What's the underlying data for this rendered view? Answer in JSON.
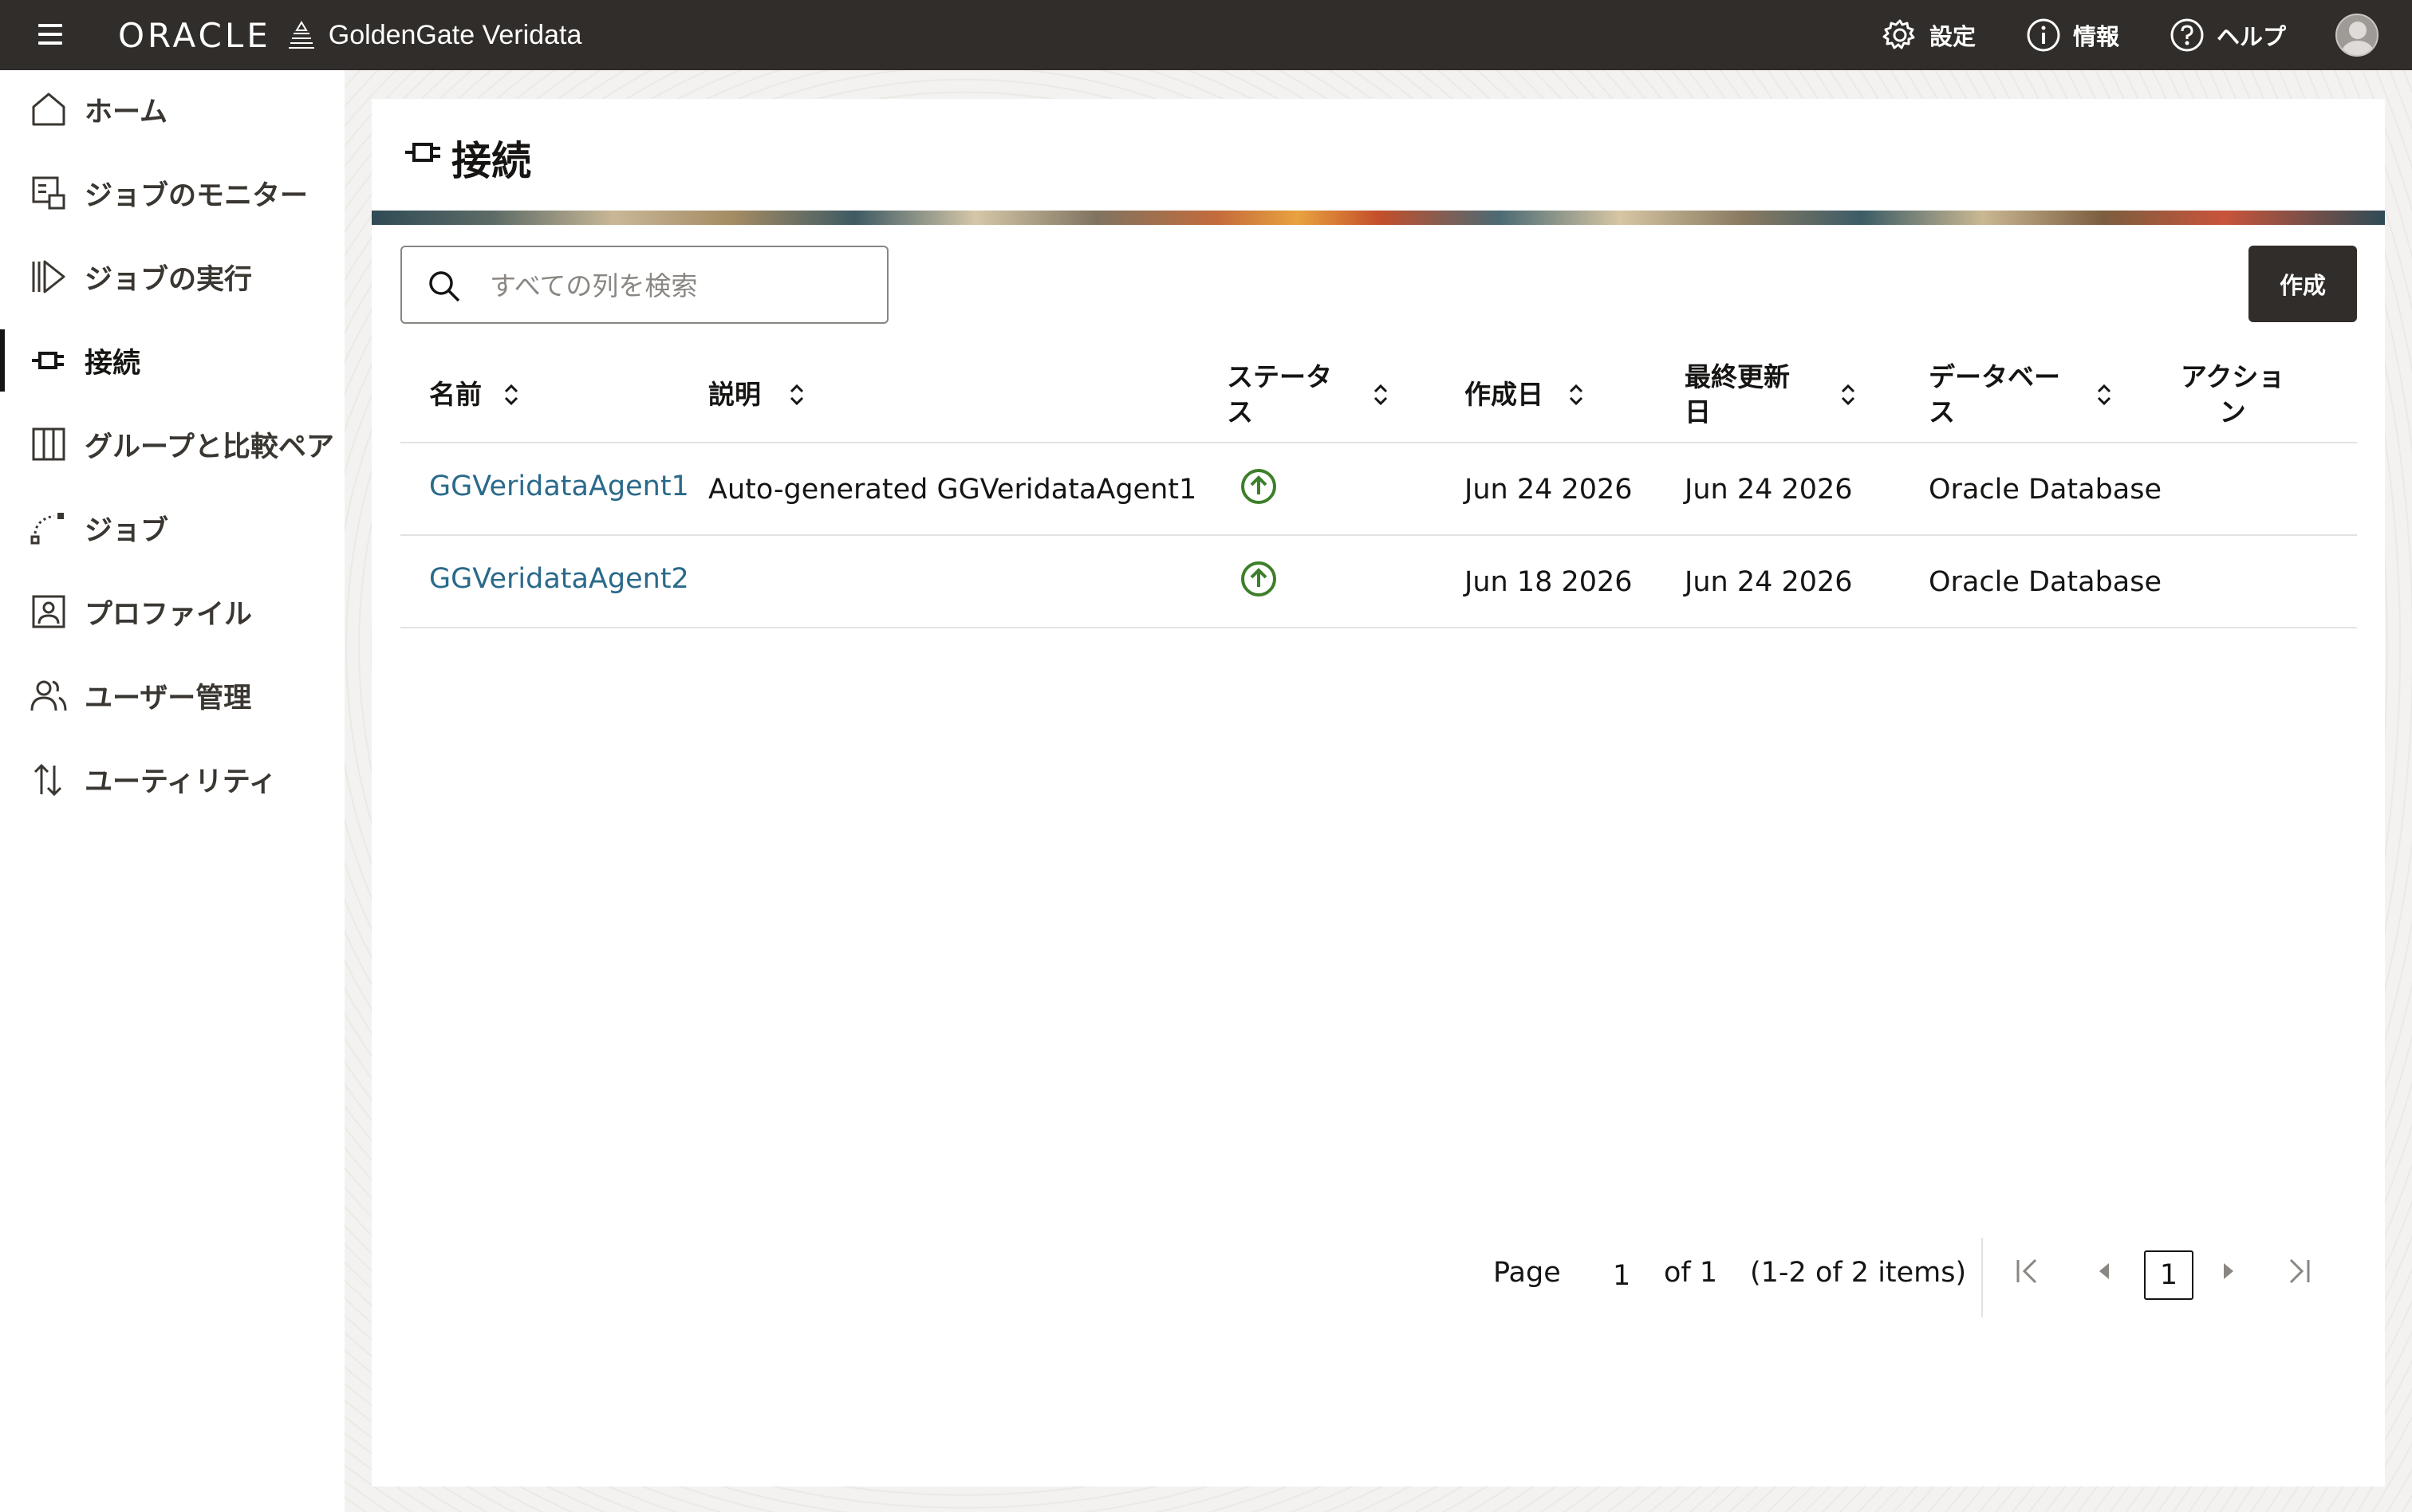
{
  "topbar": {
    "brand": "ORACLE",
    "product": "GoldenGate Veridata",
    "settings_label": "設定",
    "info_label": "情報",
    "help_label": "ヘルプ"
  },
  "sidebar": {
    "items": [
      {
        "label": "ホーム"
      },
      {
        "label": "ジョブのモニター"
      },
      {
        "label": "ジョブの実行"
      },
      {
        "label": "接続"
      },
      {
        "label": "グループと比較ペア"
      },
      {
        "label": "ジョブ"
      },
      {
        "label": "プロファイル"
      },
      {
        "label": "ユーザー管理"
      },
      {
        "label": "ユーティリティ"
      }
    ]
  },
  "page": {
    "title": "接続",
    "search_placeholder": "すべての列を検索",
    "create_label": "作成"
  },
  "table": {
    "headers": [
      "名前",
      "説明",
      "ステータス",
      "作成日",
      "最終更新日",
      "データベース",
      "アクション"
    ],
    "header_lines": [
      [
        "名前"
      ],
      [
        "説明"
      ],
      [
        "ステータ",
        "ス"
      ],
      [
        "作成日"
      ],
      [
        "最終更新",
        "日"
      ],
      [
        "データベー",
        "ス"
      ],
      [
        "アクショ",
        "ン"
      ]
    ],
    "rows": [
      {
        "name": "GGVeridataAgent1",
        "description": "Auto-generated GGVeridataAgent1",
        "status": "up",
        "created": "Jun 24 2026",
        "updated": "Jun 24 2026",
        "database": "Oracle Database"
      },
      {
        "name": "GGVeridataAgent2",
        "description": "",
        "status": "up",
        "created": "Jun 18 2026",
        "updated": "Jun 24 2026",
        "database": "Oracle Database"
      }
    ]
  },
  "pagination": {
    "page_label": "Page",
    "page_value": "1",
    "of_label": "of 1",
    "items_label": "(1-2 of 2 items)",
    "current": "1"
  },
  "colors": {
    "topbar": "#312d2a",
    "link": "#2a6a8a",
    "status_up": "#3d7f2a"
  }
}
